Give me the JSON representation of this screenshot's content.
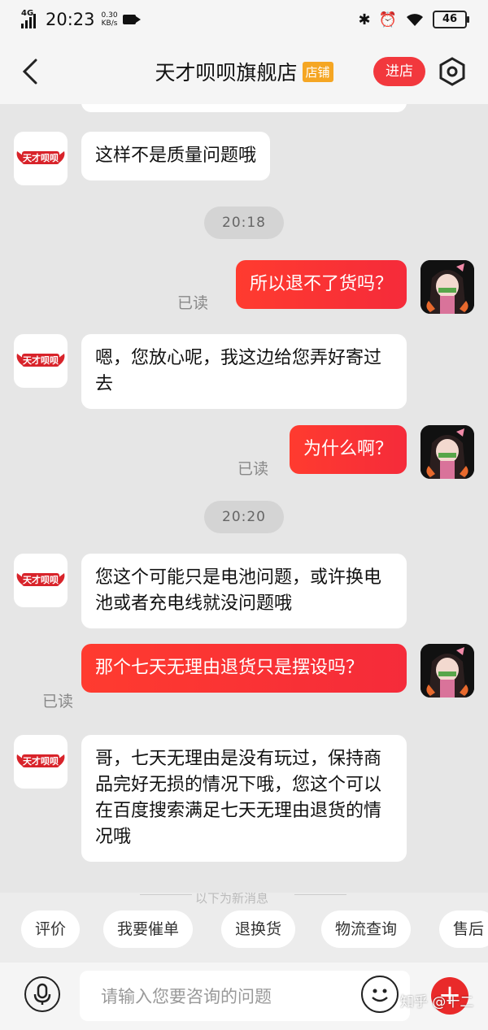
{
  "status_bar": {
    "network": "4G",
    "time": "20:23",
    "speed_value": "0.30",
    "speed_unit": "KB/s",
    "battery": "46"
  },
  "header": {
    "title": "天才呗呗旗舰店",
    "shop_tag": "店铺",
    "enter_button": "进店",
    "accent": "#f2383d"
  },
  "messages": [
    {
      "from": "shop",
      "text": "这样不是质量问题哦"
    },
    {
      "type": "time",
      "text": "20:18"
    },
    {
      "from": "user",
      "text": "所以退不了货吗？",
      "status": "已读"
    },
    {
      "from": "shop",
      "text": "嗯，您放心呢，我这边给您弄好寄过去"
    },
    {
      "from": "user",
      "text": "为什么啊？",
      "status": "已读"
    },
    {
      "type": "time",
      "text": "20:20"
    },
    {
      "from": "shop",
      "text": "您这个可能只是电池问题，或许换电池或者充电线就没问题哦"
    },
    {
      "from": "user",
      "text": "那个七天无理由退货只是摆设吗？",
      "status": "已读"
    },
    {
      "from": "shop",
      "text": "哥，七天无理由是没有玩过，保持商品完好无损的情况下哦，您这个可以在百度搜索满足七天无理由退货的情况哦"
    }
  ],
  "new_messages_hint": "以下为新消息",
  "quick_actions": [
    "评价",
    "我要催单",
    "退换货",
    "物流查询",
    "售后"
  ],
  "input": {
    "placeholder": "请输入您要咨询的问题"
  },
  "watermark": "知乎 @十二",
  "shop_logo_text": "天才呗呗"
}
